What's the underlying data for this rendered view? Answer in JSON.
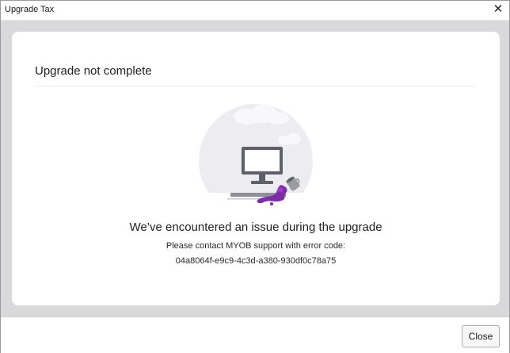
{
  "window": {
    "title": "Upgrade Tax",
    "close_glyph": "✕"
  },
  "card": {
    "title": "Upgrade not complete",
    "illustration_icon": "monitor-spilled-paint-illustration",
    "headline": "We’ve encountered an issue during the upgrade",
    "message": "Please contact MYOB support with error code:",
    "error_code": "04a8064f-e9c9-4c3d-a380-930df0c78a75"
  },
  "footer": {
    "close_label": "Close"
  },
  "colors": {
    "backdrop": "#d9d9dc",
    "card": "#ffffff",
    "accent_purple": "#7b2ea6"
  }
}
